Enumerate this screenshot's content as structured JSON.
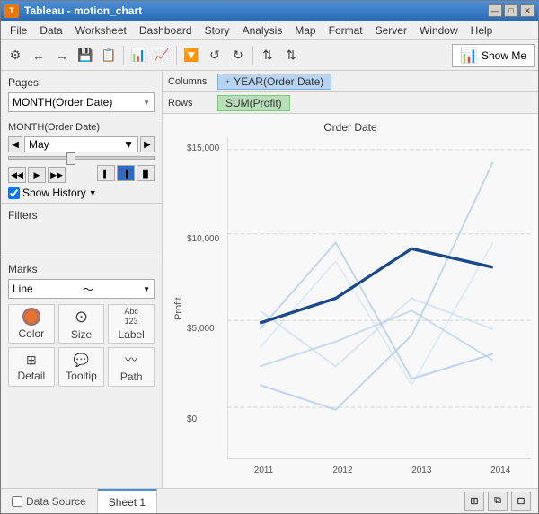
{
  "window": {
    "title": "Tableau - motion_chart",
    "controls": {
      "minimize": "—",
      "maximize": "□",
      "close": "✕"
    }
  },
  "menu": {
    "items": [
      "File",
      "Data",
      "Worksheet",
      "Dashboard",
      "Story",
      "Analysis",
      "Map",
      "Format",
      "Server",
      "Window",
      "Help"
    ]
  },
  "toolbar": {
    "show_me": "Show Me"
  },
  "shelves": {
    "columns_label": "Columns",
    "rows_label": "Rows",
    "columns_pill": "YEAR(Order Date)",
    "rows_pill": "SUM(Profit)"
  },
  "pages": {
    "label": "Pages",
    "value": "MONTH(Order Date)"
  },
  "month_control": {
    "label": "MONTH(Order Date)",
    "current": "May",
    "show_history": "Show History"
  },
  "filters": {
    "label": "Filters"
  },
  "marks": {
    "label": "Marks",
    "type": "Line",
    "buttons": [
      {
        "id": "color",
        "icon": "🎨",
        "label": "Color"
      },
      {
        "id": "size",
        "icon": "⊙",
        "label": "Size"
      },
      {
        "id": "label",
        "icon": "Abc\n123",
        "label": "Label"
      },
      {
        "id": "detail",
        "icon": "",
        "label": "Detail"
      },
      {
        "id": "tooltip",
        "icon": "",
        "label": "Tooltip"
      },
      {
        "id": "path",
        "icon": "",
        "label": "Path"
      }
    ]
  },
  "chart": {
    "title": "Order Date",
    "y_axis_label": "Profit",
    "y_ticks": [
      "$15,000",
      "$10,000",
      "$5,000",
      "$0"
    ],
    "x_ticks": [
      "2011",
      "2012",
      "2013",
      "2014"
    ]
  },
  "bottom_tabs": {
    "data_source": "Data Source",
    "sheet1": "Sheet 1"
  },
  "colors": {
    "accent": "#316ac5",
    "pill_blue": "#b8d4f0",
    "pill_green": "#b8e0b8"
  }
}
